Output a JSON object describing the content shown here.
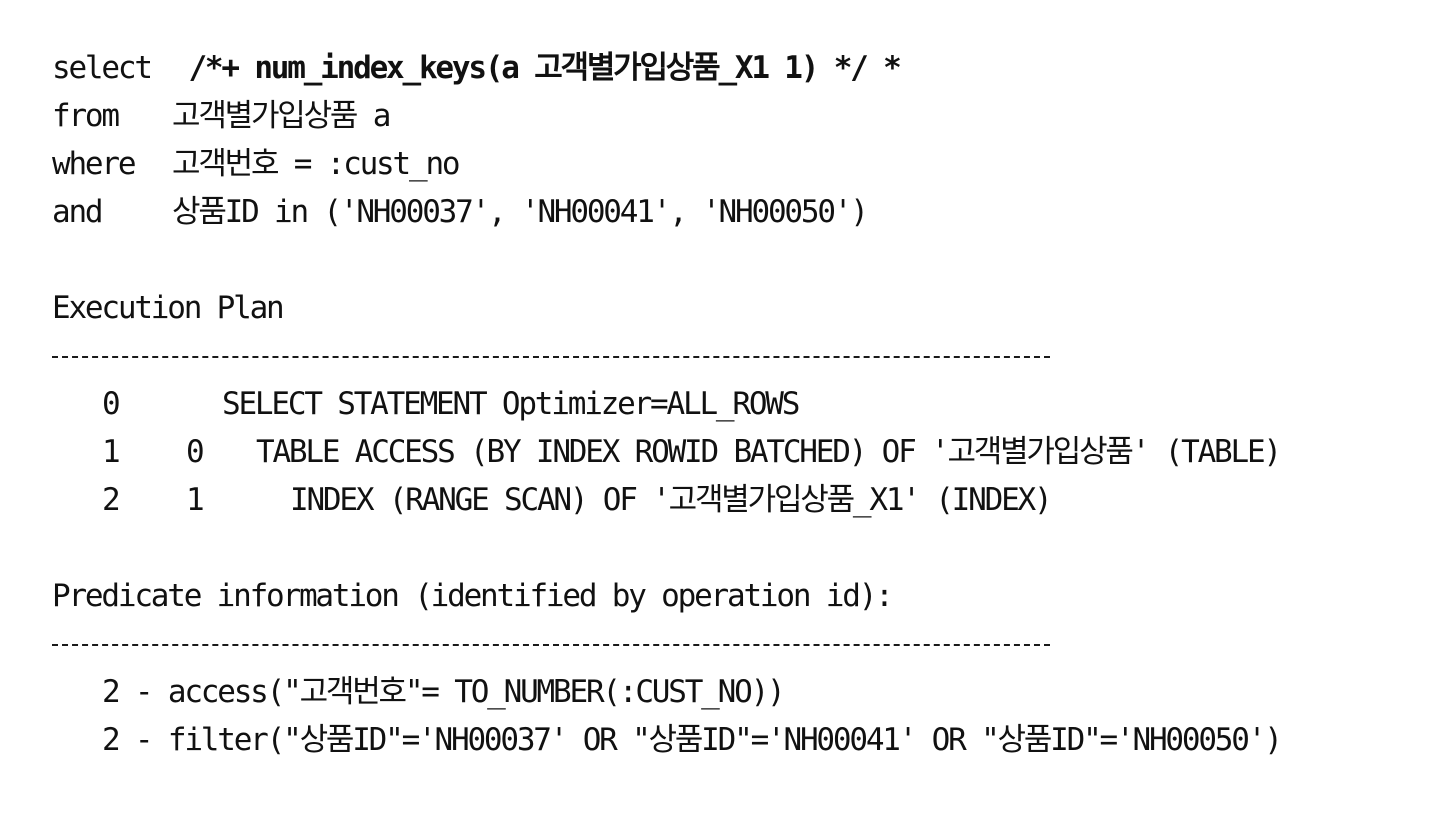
{
  "sql": {
    "select_kw": "select",
    "select_hint": "/*+ num_index_keys(a 고객별가입상품_X1 1) */",
    "select_rest": " *",
    "from_kw": "from",
    "from_rest": "고객별가입상품 a",
    "where_kw": "where",
    "where_rest": "고객번호 = :cust_no",
    "and_kw": "and",
    "and_rest": "상품ID in ('NH00037', 'NH00041', 'NH00050')"
  },
  "plan": {
    "heading": "Execution Plan",
    "rows": [
      {
        "id": "0",
        "parent": "",
        "operation": "SELECT STATEMENT Optimizer=ALL_ROWS"
      },
      {
        "id": "1",
        "parent": "0",
        "operation": "TABLE ACCESS (BY INDEX ROWID BATCHED) OF '고객별가입상품' (TABLE)"
      },
      {
        "id": "2",
        "parent": "1",
        "operation": "INDEX (RANGE SCAN) OF '고객별가입상품_X1' (INDEX)"
      }
    ]
  },
  "predicate": {
    "heading": "Predicate information (identified by operation id):",
    "items": [
      "2 - access(\"고객번호\"= TO_NUMBER(:CUST_NO))",
      "2 - filter(\"상품ID\"='NH00037' OR \"상품ID\"='NH00041' OR \"상품ID\"='NH00050')"
    ]
  }
}
